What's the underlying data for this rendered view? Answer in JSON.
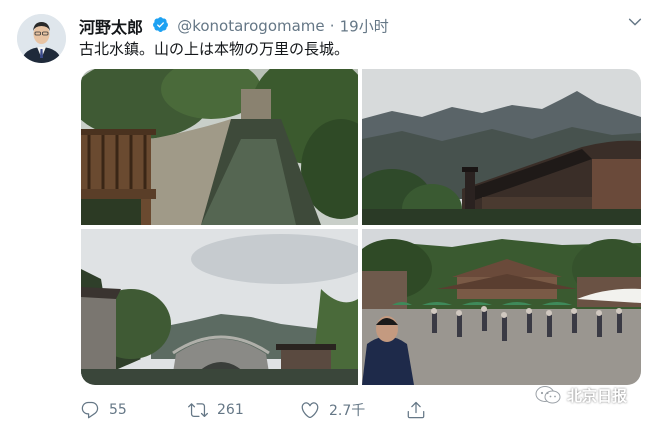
{
  "tweet": {
    "display_name": "河野太郎",
    "handle": "@konotarogomame",
    "separator": "·",
    "time": "19小时",
    "text": "古北水鎮。山の上は本物の万里の長城。"
  },
  "actions": {
    "reply_count": "55",
    "retweet_count": "261",
    "like_count": "2.7千"
  },
  "watermark": {
    "text": "北京日报"
  },
  "colors": {
    "verified": "#1da1f2",
    "secondary_text": "#657786",
    "primary_text": "#14171a"
  },
  "icons": [
    "verified-badge-icon",
    "chevron-down-icon",
    "reply-icon",
    "retweet-icon",
    "like-icon",
    "share-icon",
    "wechat-icon"
  ]
}
